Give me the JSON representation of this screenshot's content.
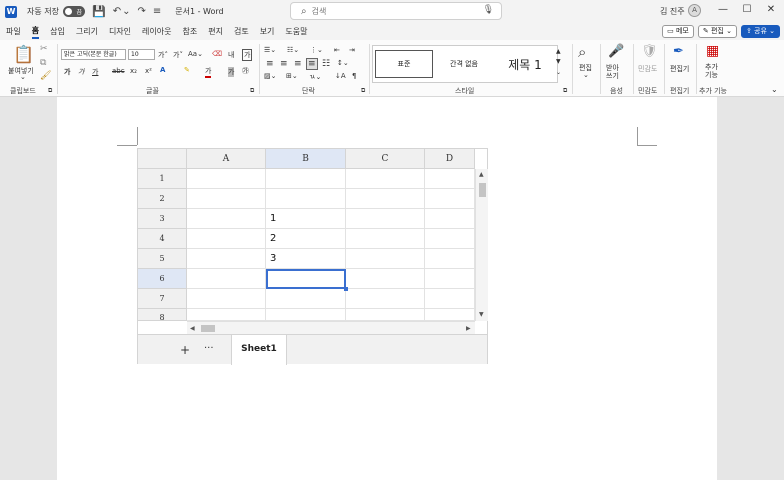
{
  "titlebar": {
    "app_logo": "W",
    "autosave_label": "자동 저장",
    "autosave_state": "끔",
    "save_icon": "💾",
    "undo_icon": "↶",
    "dropdown_icon": "⌄",
    "redo_icon": "↷",
    "customize_icon": "≡",
    "doc_title": "문서1 - Word",
    "search_placeholder": "검색",
    "search_icon": "⌕",
    "mic_icon": "🎙",
    "user_name": "김 진주",
    "user_avatar": "A",
    "minimize": "—",
    "maximize": "☐",
    "close": "✕"
  },
  "tabs": {
    "items": [
      "파일",
      "홈",
      "삽입",
      "그리기",
      "디자인",
      "레이아웃",
      "참조",
      "편지",
      "검토",
      "보기",
      "도움말"
    ],
    "active_index": 1,
    "memo_label": "▭ 메모",
    "edit_label": "✎ 편집 ⌄",
    "share_label": "⇪ 공유 ⌄"
  },
  "ribbon": {
    "clipboard": {
      "label": "클립보드",
      "paste": "붙여넣기",
      "paste_arrow": "⌄",
      "launcher": "⧉"
    },
    "font": {
      "label": "글꼴",
      "font_name": "맑은 고딕(본문 한글)",
      "font_size": "10",
      "grow": "가˄",
      "shrink": "가˅",
      "case": "Aa⌄",
      "clear": "⌫",
      "phonetic": "내",
      "charbox": "가",
      "bold": "가",
      "italic": "가",
      "underline": "가",
      "strike": "abc",
      "subscript": "x₂",
      "superscript": "x²",
      "effects": "A",
      "highlight": "✎",
      "font_color": "가",
      "shade": "가",
      "encircle": "㉮",
      "launcher": "⧉"
    },
    "paragraph": {
      "label": "단락",
      "bullets": "☰⌄",
      "numbering": "☷⌄",
      "multilevel": "⋮⌄",
      "dec_indent": "⇤",
      "inc_indent": "⇥",
      "align_left": "≡",
      "align_center": "≡",
      "align_right": "≡",
      "justify": "≡",
      "distributed": "☷",
      "line_spacing": "↕⌄",
      "shading": "▨⌄",
      "borders": "⊞⌄",
      "asian": "ㄳ⌄",
      "sort": "↓A",
      "show_marks": "¶",
      "launcher": "⧉"
    },
    "styles": {
      "label": "스타일",
      "items": [
        "표준",
        "간격 없음",
        "제목 1"
      ],
      "selected_index": 0,
      "launcher": "⧉"
    },
    "editing": {
      "label": "편집",
      "icon": "⌕"
    },
    "voice": {
      "label": "음성",
      "dictate": "받아\n쓰기",
      "icon": "🎤"
    },
    "sensitivity": {
      "label": "민감도",
      "text": "민감도",
      "icon": "🛡"
    },
    "editor": {
      "label": "편집기",
      "text": "편집기",
      "icon": "✒"
    },
    "addins": {
      "label": "추가 기능",
      "text": "추가\n기능",
      "icon": "▦"
    },
    "collapse": "⌄"
  },
  "spreadsheet": {
    "columns": [
      "A",
      "B",
      "C",
      "D"
    ],
    "selected_column": "B",
    "rows": [
      "1",
      "2",
      "3",
      "4",
      "5",
      "6",
      "7",
      "8"
    ],
    "selected_row": "6",
    "cells": [
      [
        "",
        "",
        "",
        ""
      ],
      [
        "",
        "",
        "",
        ""
      ],
      [
        "",
        "1",
        "",
        ""
      ],
      [
        "",
        "2",
        "",
        ""
      ],
      [
        "",
        "3",
        "",
        ""
      ],
      [
        "",
        "",
        "",
        ""
      ],
      [
        "",
        "",
        "",
        ""
      ],
      [
        "",
        "",
        "",
        ""
      ]
    ],
    "active_cell": "B6",
    "scroll_up": "▲",
    "scroll_down": "▼",
    "scroll_left": "◀",
    "scroll_right": "▶",
    "add_sheet": "+",
    "more_sheets": "···",
    "sheet_tab": "Sheet1"
  }
}
